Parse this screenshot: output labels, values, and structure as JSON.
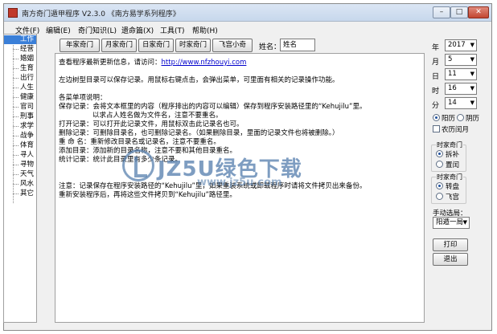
{
  "window": {
    "title": "南方奇门遁甲程序 V2.3.0 《南方易学系列程序》",
    "minimize": "–",
    "maximize": "□",
    "close": "✕"
  },
  "menu": [
    "文件(F)",
    "编辑(E)",
    "奇门知识(L)",
    "遗命篇(X)",
    "工具(T)",
    "帮助(H)"
  ],
  "sidebar": {
    "items": [
      "工作",
      "经营",
      "婚姻",
      "生育",
      "出行",
      "人生",
      "健康",
      "官司",
      "刑事",
      "求学",
      "战争",
      "体育",
      "寻人",
      "寻物",
      "天气",
      "风水",
      "其它"
    ],
    "selected_index": 0
  },
  "toolbar": {
    "buttons": [
      "年家奇门",
      "月家奇门",
      "日家奇门",
      "时家奇门",
      "飞宫小奇"
    ],
    "name_label": "姓名：",
    "name_value": "姓名"
  },
  "content": {
    "line1_prefix": "查看程序最新更新信息，请访问：",
    "link": "http://www.nfzhouyi.com",
    "lines": [
      "左边树型目录可以保存记录。用鼠标右键点击，会弹出菜单，可里面有相关的记录操作功能。",
      "各菜单项说明：",
      "保存记录：会将文本框里的内容（程序排出的内容可以编辑）保存到程序安装路径里的“Kehujilu”里。",
      "以求占人姓名做为文件名，注意不要重名。",
      "打开记录：可以打开此记录文件，用鼠标双击此记录名也可。",
      "删除记录：可删除目录名，也可删除记录名。（如果删除目录，里面的记录文件也将被删除。）",
      "重 命 名：重新修改目录名或记录名，注意不要重名。",
      "添加目录：添加新的目录名称，注意不要和其他目录重名。",
      "统计记录：统计此目录里有多少条记录。",
      "注意：记录保存在程序安装路径的“Kehujilu”里，如果重装系统或卸载程序时请将文件拷贝出来备份。",
      "重新安装程序后，再将这些文件拷贝到“Kehujilu”路径里。"
    ]
  },
  "watermark": {
    "text": "JZ5U绿色下载",
    "url": "www.jz5u.com"
  },
  "right_panel": {
    "year_label": "年",
    "year": "2017",
    "month_label": "月",
    "month": "5",
    "day_label": "日",
    "day": "11",
    "hour_label": "时",
    "hour": "16",
    "minute_label": "分",
    "minute": "14",
    "calendar": [
      "阳历",
      "阴历"
    ],
    "calendar_selected": 0,
    "lunar_leap_label": "农历闰月",
    "group1_title": "时家奇门",
    "group1_options": [
      "拆补",
      "置闰"
    ],
    "group1_selected": 0,
    "group2_title": "时家奇门",
    "group2_options": [
      "转盘",
      "飞宫"
    ],
    "group2_selected": 0,
    "manual_label": "手动选局：",
    "manual_value": "阳遁一局",
    "print_button": "打印",
    "exit_button": "退出"
  }
}
